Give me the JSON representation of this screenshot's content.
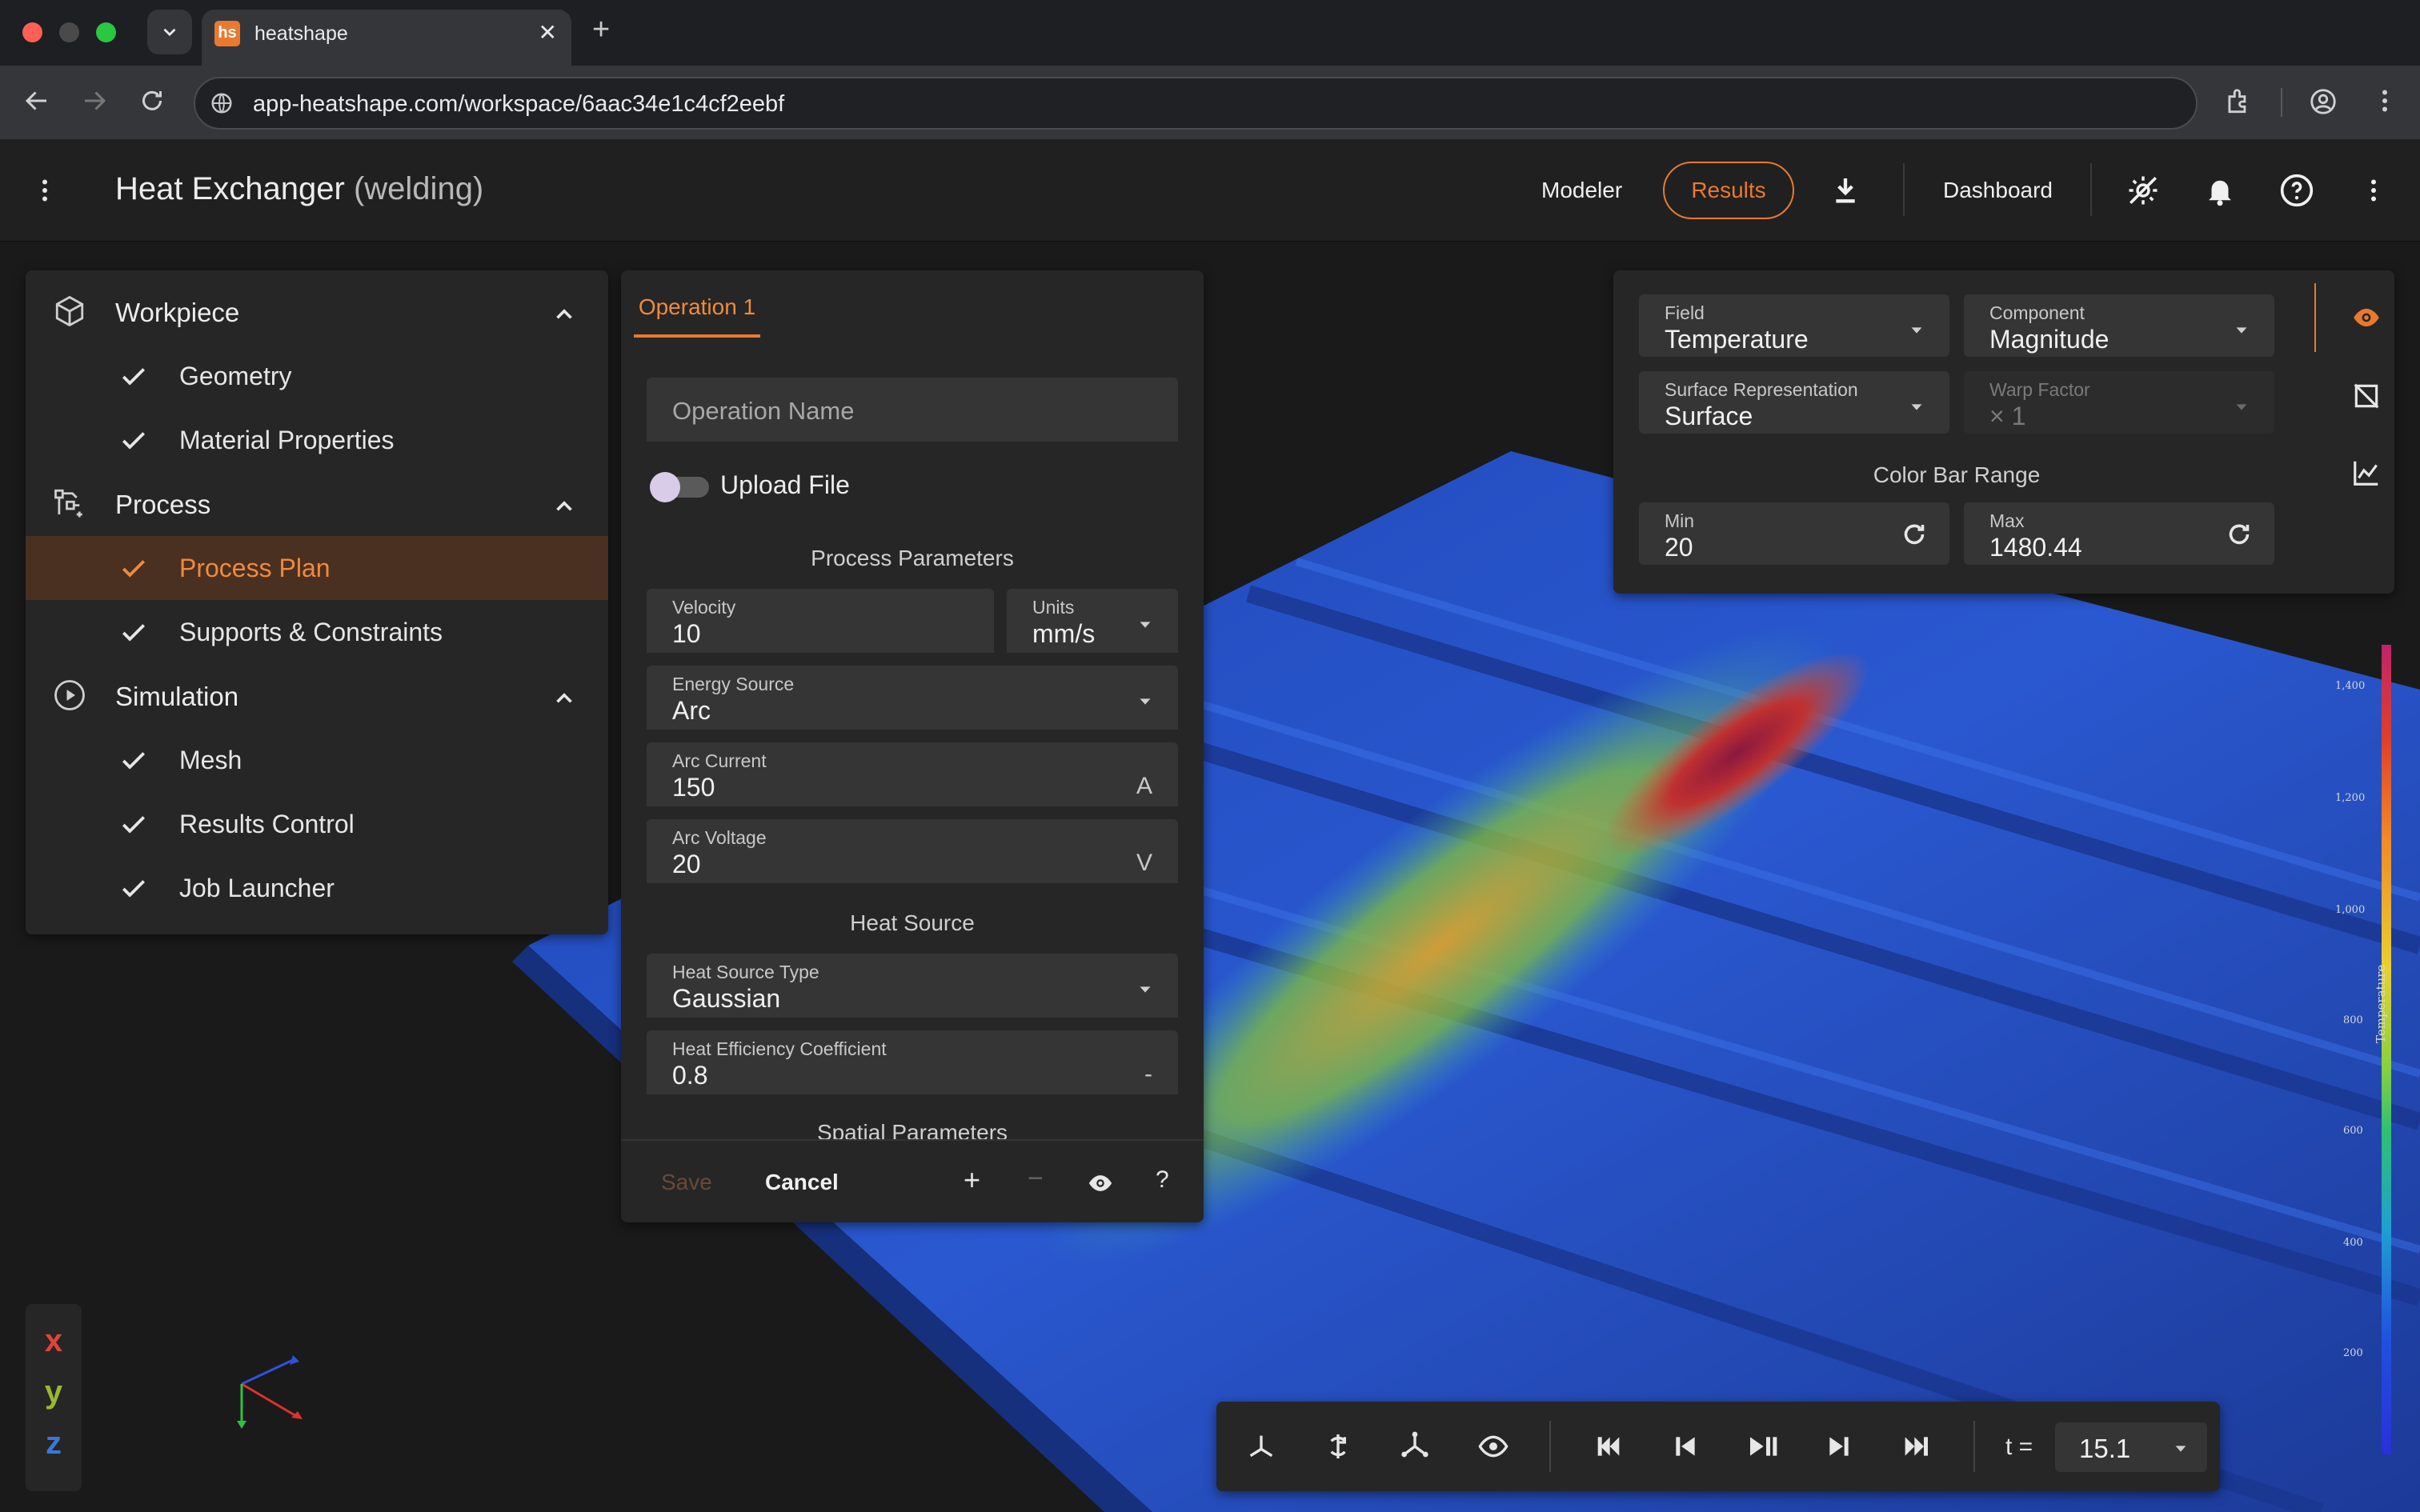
{
  "browser": {
    "tab_title": "heatshape",
    "favicon_text": "hs",
    "url": "app-heatshape.com/workspace/6aac34e1c4cf2eebf"
  },
  "header": {
    "title": "Heat Exchanger",
    "subtitle": "(welding)",
    "modeler_label": "Modeler",
    "results_label": "Results",
    "dashboard_label": "Dashboard"
  },
  "sidebar": {
    "sections": [
      {
        "label": "Workpiece",
        "icon": "cube-icon",
        "items": [
          "Geometry",
          "Material Properties"
        ]
      },
      {
        "label": "Process",
        "icon": "process-graph-icon",
        "items": [
          "Process Plan",
          "Supports & Constraints"
        ]
      },
      {
        "label": "Simulation",
        "icon": "play-circle-icon",
        "items": [
          "Mesh",
          "Results Control",
          "Job Launcher"
        ]
      }
    ],
    "active_item": "Process Plan"
  },
  "operation": {
    "tab_label": "Operation 1",
    "name_placeholder": "Operation Name",
    "upload_label": "Upload File",
    "upload_enabled": false,
    "process_params_heading": "Process Parameters",
    "velocity_label": "Velocity",
    "velocity_value": "10",
    "units_label": "Units",
    "units_value": "mm/s",
    "energy_source_label": "Energy Source",
    "energy_source_value": "Arc",
    "arc_current_label": "Arc Current",
    "arc_current_value": "150",
    "arc_current_unit": "A",
    "arc_voltage_label": "Arc Voltage",
    "arc_voltage_value": "20",
    "arc_voltage_unit": "V",
    "heat_source_heading": "Heat Source",
    "heat_source_type_label": "Heat Source Type",
    "heat_source_type_value": "Gaussian",
    "heat_eff_label": "Heat Efficiency Coefficient",
    "heat_eff_value": "0.8",
    "heat_eff_unit": "-",
    "spatial_heading": "Spatial Parameters",
    "save_label": "Save",
    "cancel_label": "Cancel",
    "plus_label": "+",
    "minus_label": "−",
    "help_label": "?"
  },
  "results_panel": {
    "field_label": "Field",
    "field_value": "Temperature",
    "component_label": "Component",
    "component_value": "Magnitude",
    "surface_rep_label": "Surface Representation",
    "surface_rep_value": "Surface",
    "warp_label": "Warp Factor",
    "warp_value": "× 1",
    "color_bar_heading": "Color Bar Range",
    "min_label": "Min",
    "min_value": "20",
    "max_label": "Max",
    "max_value": "1480.44"
  },
  "colorbar": {
    "title": "Temperature",
    "ticks": [
      "1,400",
      "1,200",
      "1,000",
      "800",
      "600",
      "400",
      "200"
    ]
  },
  "axes": {
    "x": "x",
    "y": "y",
    "z": "z"
  },
  "playback": {
    "t_label": "t =",
    "t_value": "15.1"
  },
  "colors": {
    "accent": "#e8792f",
    "panel": "#262626",
    "field": "#353535"
  }
}
